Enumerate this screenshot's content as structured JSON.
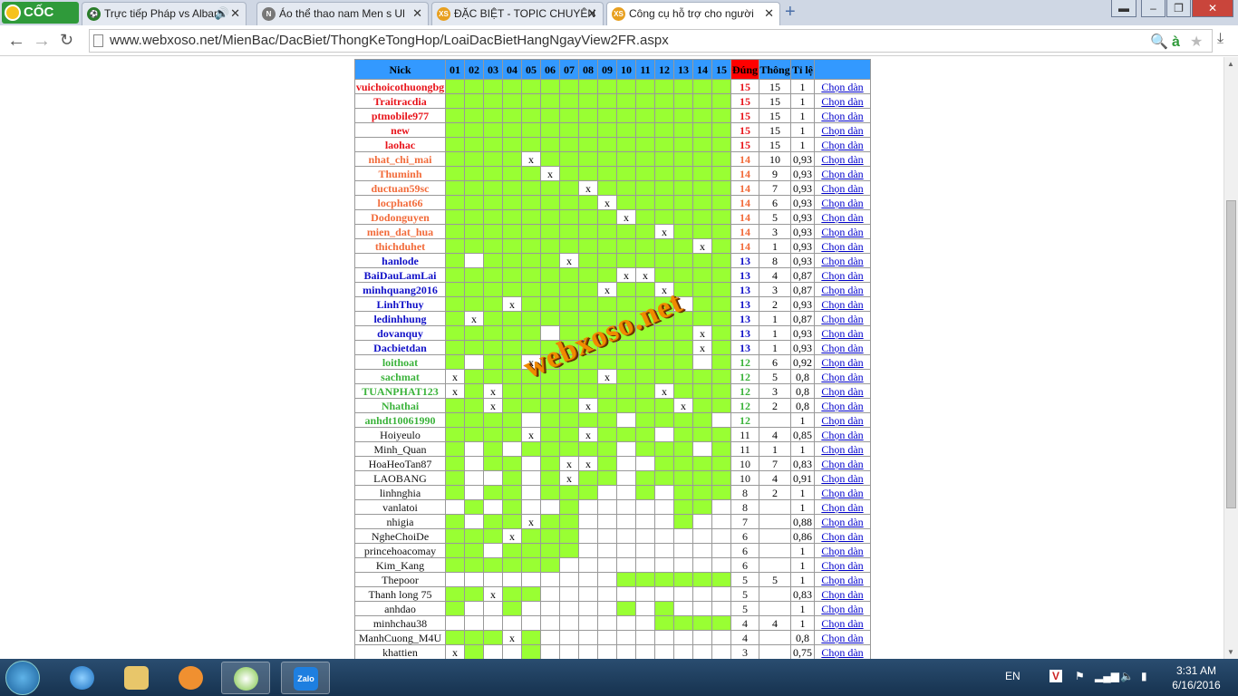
{
  "browser": {
    "brand": "CỐC CỐC",
    "tabs": [
      {
        "title": "Trực tiếp Pháp vs Alban",
        "icon": "soccer-ball-icon"
      },
      {
        "title": "Áo thể thao nam Men s Ul",
        "icon": "n-icon"
      },
      {
        "title": "ĐẶC BIỆT - TOPIC CHUYÊN",
        "icon": "xs-icon"
      },
      {
        "title": "Công cụ hỗ trợ cho người",
        "icon": "xs-icon"
      }
    ],
    "url": "www.webxoso.net/MienBac/DacBiet/ThongKeTongHop/LoaiDacBietHangNgayView2FR.aspx"
  },
  "table": {
    "headers": {
      "nick": "Nick",
      "days": [
        "01",
        "02",
        "03",
        "04",
        "05",
        "06",
        "07",
        "08",
        "09",
        "10",
        "11",
        "12",
        "13",
        "14",
        "15"
      ],
      "dung": "Đúng",
      "thong": "Thông",
      "tile": "Tỉ lệ"
    },
    "link_text": "Chọn dàn",
    "rows": [
      {
        "nick": "vuichoicothuongbg",
        "color": "#e8141b",
        "cells": "ggggggggggggggg",
        "dung": "15",
        "thong": "15",
        "tile": "1"
      },
      {
        "nick": "Traitracdia",
        "color": "#e8141b",
        "cells": "ggggggggggggggg",
        "dung": "15",
        "thong": "15",
        "tile": "1"
      },
      {
        "nick": "ptmobile977",
        "color": "#e8141b",
        "cells": "ggggggggggggggg",
        "dung": "15",
        "thong": "15",
        "tile": "1"
      },
      {
        "nick": "new",
        "color": "#e8141b",
        "cells": "ggggggggggggggg",
        "dung": "15",
        "thong": "15",
        "tile": "1"
      },
      {
        "nick": "laohac",
        "color": "#e8141b",
        "cells": "ggggggggggggggg",
        "dung": "15",
        "thong": "15",
        "tile": "1"
      },
      {
        "nick": "nhat_chi_mai",
        "color": "#f26b3a",
        "cells": "ggggxgggggggggg",
        "dung": "14",
        "thong": "10",
        "tile": "0,93"
      },
      {
        "nick": "Thuminh",
        "color": "#f26b3a",
        "cells": "gggggxggggggggg",
        "dung": "14",
        "thong": "9",
        "tile": "0,93"
      },
      {
        "nick": "ductuan59sc",
        "color": "#f26b3a",
        "cells": "gggggggxggggggg",
        "dung": "14",
        "thong": "7",
        "tile": "0,93"
      },
      {
        "nick": "locphat66",
        "color": "#f26b3a",
        "cells": "ggggggggxgggggg",
        "dung": "14",
        "thong": "6",
        "tile": "0,93"
      },
      {
        "nick": "Dodonguyen",
        "color": "#f26b3a",
        "cells": "gggggggggxggggg",
        "dung": "14",
        "thong": "5",
        "tile": "0,93"
      },
      {
        "nick": "mien_dat_hua",
        "color": "#f26b3a",
        "cells": "gggggggggggxggg",
        "dung": "14",
        "thong": "3",
        "tile": "0,93"
      },
      {
        "nick": "thichduhet",
        "color": "#f26b3a",
        "cells": "gggggggggggggxg",
        "dung": "14",
        "thong": "1",
        "tile": "0,93"
      },
      {
        "nick": "hanlode",
        "color": "#1111c8",
        "cells": "gwggggxgggggggg",
        "dung": "13",
        "thong": "8",
        "tile": "0,93"
      },
      {
        "nick": "BaiDauLamLai",
        "color": "#1111c8",
        "cells": "gggggggggxxgggg",
        "dung": "13",
        "thong": "4",
        "tile": "0,87"
      },
      {
        "nick": "minhquang2016",
        "color": "#1111c8",
        "cells": "ggggggggxggxggg",
        "dung": "13",
        "thong": "3",
        "tile": "0,87"
      },
      {
        "nick": "LinhThuy",
        "color": "#1111c8",
        "cells": "gggxggggggggwgg",
        "dung": "13",
        "thong": "2",
        "tile": "0,93"
      },
      {
        "nick": "ledinhhung",
        "color": "#1111c8",
        "cells": "gxggggggggggggg",
        "dung": "13",
        "thong": "1",
        "tile": "0,87"
      },
      {
        "nick": "dovanquy",
        "color": "#1111c8",
        "cells": "gggggwgggggggxg",
        "dung": "13",
        "thong": "1",
        "tile": "0,93"
      },
      {
        "nick": "Dacbietdan",
        "color": "#1111c8",
        "cells": "gggggggggggggxg",
        "dung": "13",
        "thong": "1",
        "tile": "0,93"
      },
      {
        "nick": "loithoat",
        "color": "#3bb33b",
        "cells": "gwggxggggggggwg",
        "dung": "12",
        "thong": "6",
        "tile": "0,92"
      },
      {
        "nick": "sachmat",
        "color": "#3bb33b",
        "cells": "xgggggggxgggggg",
        "dung": "12",
        "thong": "5",
        "tile": "0,8"
      },
      {
        "nick": "TUANPHAT123",
        "color": "#3bb33b",
        "cells": "xgxggggggggxggg",
        "dung": "12",
        "thong": "3",
        "tile": "0,8"
      },
      {
        "nick": "Nhathai",
        "color": "#3bb33b",
        "cells": "ggxggggxggggxgg",
        "dung": "12",
        "thong": "2",
        "tile": "0,8"
      },
      {
        "nick": "anhdt10061990",
        "color": "#3bb33b",
        "cells": "ggggwggggwggggw",
        "dung": "12",
        "thong": "",
        "tile": "1"
      },
      {
        "nick": "Hoiyeulo",
        "color": "#111111",
        "cells": "ggggxggxgggwggg",
        "dung": "11",
        "thong": "4",
        "tile": "0,85"
      },
      {
        "nick": "Minh_Quan",
        "color": "#111111",
        "cells": "gwgwgggggwgggwg",
        "dung": "11",
        "thong": "1",
        "tile": "1"
      },
      {
        "nick": "HoaHeoTan87",
        "color": "#111111",
        "cells": "gwggwgxxgwwgggg",
        "dung": "10",
        "thong": "7",
        "tile": "0,83"
      },
      {
        "nick": "LAOBANG",
        "color": "#111111",
        "cells": "gwwgwgxggwggggg",
        "dung": "10",
        "thong": "4",
        "tile": "0,91"
      },
      {
        "nick": "linhnghia",
        "color": "#111111",
        "cells": "gwggwgggwwgwggg",
        "dung": "8",
        "thong": "2",
        "tile": "1"
      },
      {
        "nick": "vanlatoi",
        "color": "#111111",
        "cells": "wgwgwwgwwwwwggw",
        "dung": "8",
        "thong": "",
        "tile": "1"
      },
      {
        "nick": "nhigia",
        "color": "#111111",
        "cells": "gwggxggwwwwwgww",
        "dung": "7",
        "thong": "",
        "tile": "0,88"
      },
      {
        "nick": "NgheChoiDe",
        "color": "#111111",
        "cells": "gggxgggwwwwwwww",
        "dung": "6",
        "thong": "",
        "tile": "0,86"
      },
      {
        "nick": "princehoacomay",
        "color": "#111111",
        "cells": "ggwggggwwwwwwww",
        "dung": "6",
        "thong": "",
        "tile": "1"
      },
      {
        "nick": "Kim_Kang",
        "color": "#111111",
        "cells": "ggggggwwwwwwwww",
        "dung": "6",
        "thong": "",
        "tile": "1"
      },
      {
        "nick": "Thepoor",
        "color": "#111111",
        "cells": "wwwwwwwwwgggggg",
        "dung": "5",
        "thong": "5",
        "tile": "1"
      },
      {
        "nick": "Thanh long 75",
        "color": "#111111",
        "cells": "ggxggwwwwwwwwww",
        "dung": "5",
        "thong": "",
        "tile": "0,83"
      },
      {
        "nick": "anhdao",
        "color": "#111111",
        "cells": "gwwgwwwwwgwgwww",
        "dung": "5",
        "thong": "",
        "tile": "1"
      },
      {
        "nick": "minhchau38",
        "color": "#111111",
        "cells": "wwwwwwwwwwwgggg",
        "dung": "4",
        "thong": "4",
        "tile": "1"
      },
      {
        "nick": "ManhCuong_M4U",
        "color": "#111111",
        "cells": "gggxgwwwwwwwwww",
        "dung": "4",
        "thong": "",
        "tile": "0,8"
      },
      {
        "nick": "khattien",
        "color": "#111111",
        "cells": "xgwwgwwwwwwwwww",
        "dung": "3",
        "thong": "",
        "tile": "0,75"
      }
    ]
  },
  "watermark": "webxoso.net",
  "taskbar": {
    "lang": "EN",
    "time": "3:31 AM",
    "date": "6/16/2016",
    "zalo": "Zalo"
  }
}
